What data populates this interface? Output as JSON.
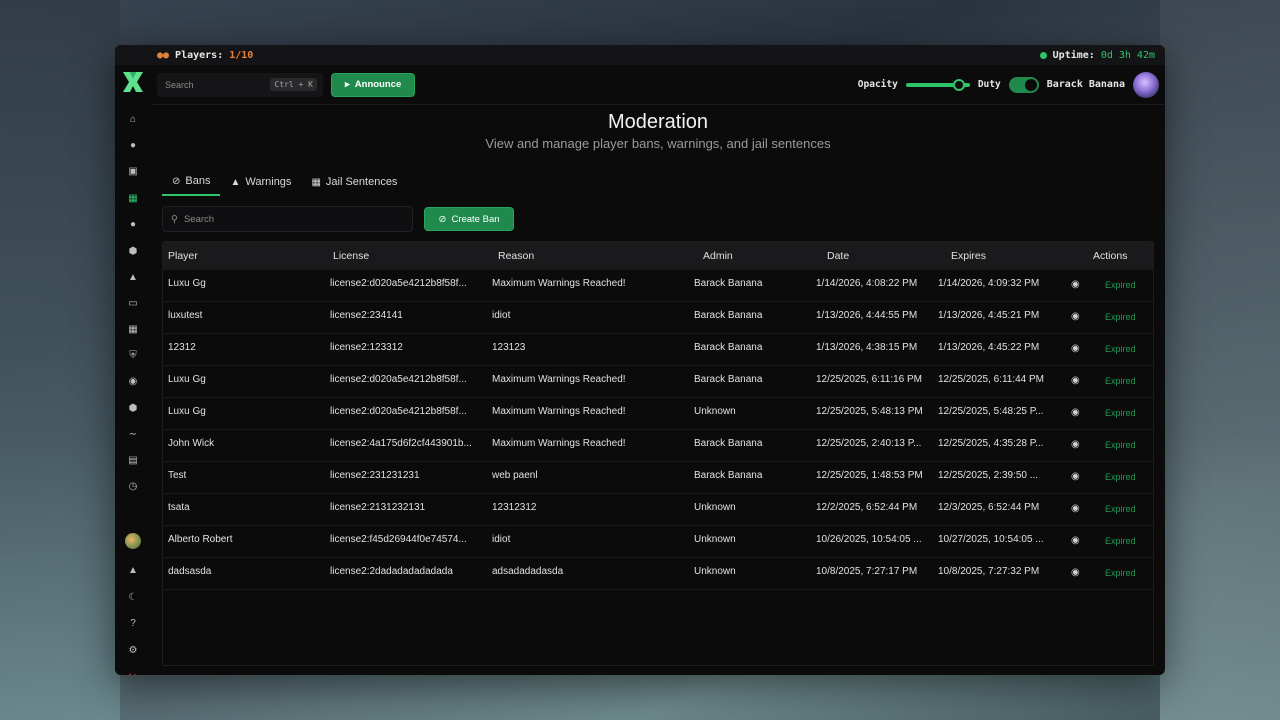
{
  "topbar": {
    "players_label": "Players:",
    "players_value": "1/10",
    "uptime_label": "Uptime:",
    "uptime_value": "0d 3h 42m"
  },
  "header": {
    "search_placeholder": "Search",
    "search_shortcut": "Ctrl + K",
    "announce_label": "Announce",
    "opacity_label": "Opacity",
    "opacity_value": 0.9,
    "duty_label": "Duty",
    "duty_on": true,
    "user_name": "Barack Banana"
  },
  "page": {
    "title": "Moderation",
    "subtitle": "View and manage player bans, warnings, and jail sentences"
  },
  "tabs": [
    {
      "label": "Bans",
      "icon": "ban-icon",
      "active": true
    },
    {
      "label": "Warnings",
      "icon": "warning-icon",
      "active": false
    },
    {
      "label": "Jail Sentences",
      "icon": "jail-icon",
      "active": false
    }
  ],
  "toolbar": {
    "search_placeholder": "Search",
    "create_label": "Create Ban"
  },
  "table": {
    "headers": [
      "Player",
      "License",
      "Reason",
      "Admin",
      "Date",
      "Expires",
      "Actions"
    ],
    "rows": [
      {
        "player": "Luxu Gg",
        "license": "license2:d020a5e4212b8f58f...",
        "reason": "Maximum Warnings Reached!",
        "admin": "Barack Banana",
        "date": "1/14/2026, 4:08:22 PM",
        "expires": "1/14/2026, 4:09:32 PM",
        "status": "Expired"
      },
      {
        "player": "luxutest",
        "license": "license2:234141",
        "reason": "idiot",
        "admin": "Barack Banana",
        "date": "1/13/2026, 4:44:55 PM",
        "expires": "1/13/2026, 4:45:21 PM",
        "status": "Expired"
      },
      {
        "player": "12312",
        "license": "license2:123312",
        "reason": "123123",
        "admin": "Barack Banana",
        "date": "1/13/2026, 4:38:15 PM",
        "expires": "1/13/2026, 4:45:22 PM",
        "status": "Expired"
      },
      {
        "player": "Luxu Gg",
        "license": "license2:d020a5e4212b8f58f...",
        "reason": "Maximum Warnings Reached!",
        "admin": "Barack Banana",
        "date": "12/25/2025, 6:11:16 PM",
        "expires": "12/25/2025, 6:11:44 PM",
        "status": "Expired"
      },
      {
        "player": "Luxu Gg",
        "license": "license2:d020a5e4212b8f58f...",
        "reason": "Maximum Warnings Reached!",
        "admin": "Unknown",
        "date": "12/25/2025, 5:48:13 PM",
        "expires": "12/25/2025, 5:48:25 P...",
        "status": "Expired"
      },
      {
        "player": "John Wick",
        "license": "license2:4a175d6f2cf443901b...",
        "reason": "Maximum Warnings Reached!",
        "admin": "Barack Banana",
        "date": "12/25/2025, 2:40:13 P...",
        "expires": "12/25/2025, 4:35:28 P...",
        "status": "Expired"
      },
      {
        "player": "Test",
        "license": "license2:231231231",
        "reason": "web paenl",
        "admin": "Barack Banana",
        "date": "12/25/2025, 1:48:53 PM",
        "expires": "12/25/2025, 2:39:50 ...",
        "status": "Expired"
      },
      {
        "player": "tsata",
        "license": "license2:2131232131",
        "reason": "12312312",
        "admin": "Unknown",
        "date": "12/2/2025, 6:52:44 PM",
        "expires": "12/3/2025, 6:52:44 PM",
        "status": "Expired"
      },
      {
        "player": "Alberto Robert",
        "license": "license2:f45d26944f0e74574...",
        "reason": "idiot",
        "admin": "Unknown",
        "date": "10/26/2025, 10:54:05 ...",
        "expires": "10/27/2025, 10:54:05 ...",
        "status": "Expired"
      },
      {
        "player": "dadsasda",
        "license": "license2:2dadadadadadada",
        "reason": "adsadadadasda",
        "admin": "Unknown",
        "date": "10/8/2025, 7:27:17 PM",
        "expires": "10/8/2025, 7:27:32 PM",
        "status": "Expired"
      }
    ]
  },
  "colors": {
    "accent": "#2fc46a",
    "accent_dark": "#1f8a4c",
    "danger": "#e04848",
    "players": "#e5823a"
  }
}
